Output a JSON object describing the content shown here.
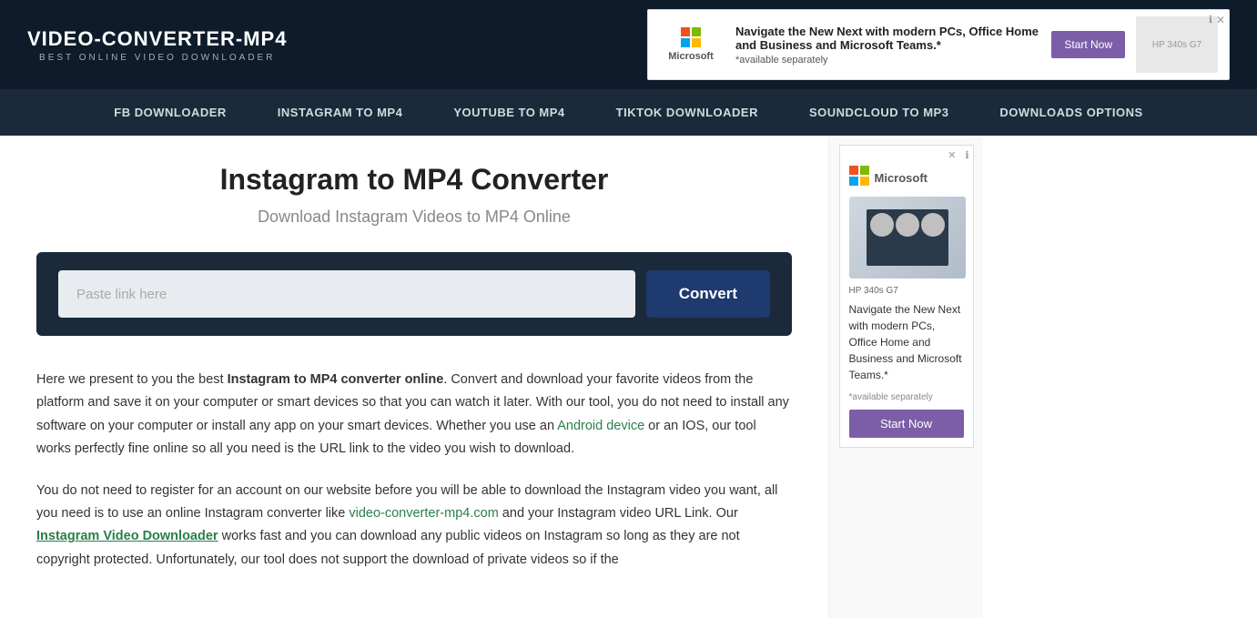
{
  "header": {
    "logo": {
      "title": "VIDEO-CONVERTER-MP4",
      "subtitle": "BEST ONLINE VIDEO DOWNLOADER"
    },
    "ad": {
      "brand": "Microsoft",
      "headline": "Navigate the New Next with modern PCs, Office Home and Business and Microsoft Teams.*",
      "footnote": "*available separately",
      "laptop_label": "HP 340s G7",
      "cta": "Start Now",
      "close": "✕",
      "info": "ℹ"
    }
  },
  "nav": {
    "items": [
      "FB DOWNLOADER",
      "INSTAGRAM TO MP4",
      "YOUTUBE TO MP4",
      "TIKTOK DOWNLOADER",
      "SOUNDCLOUD TO MP3",
      "DOWNLOADS OPTIONS"
    ]
  },
  "main": {
    "title": "Instagram to MP4 Converter",
    "subtitle": "Download Instagram Videos to MP4 Online",
    "input_placeholder": "Paste link here",
    "convert_button": "Convert",
    "body_paragraphs": [
      {
        "id": "p1",
        "parts": [
          {
            "type": "text",
            "content": "Here we present to you the best "
          },
          {
            "type": "bold",
            "content": "Instagram to MP4 converter online"
          },
          {
            "type": "text",
            "content": ". Convert and download your favorite videos from the platform and save it on your computer or smart devices so that you can watch it later. With our tool, you do not need to install any software on your computer or install any app on your smart devices. Whether you use an "
          },
          {
            "type": "link",
            "content": "Android device",
            "href": "#"
          },
          {
            "type": "text",
            "content": " or an IOS, our tool works perfectly fine online so all you need is the URL link to the video you wish to download."
          }
        ]
      },
      {
        "id": "p2",
        "parts": [
          {
            "type": "text",
            "content": "You do not need to register for an account on our website before you will be able to download the Instagram video you want, all you need is to use an online Instagram converter like "
          },
          {
            "type": "link",
            "content": "video-converter-mp4.com",
            "href": "#"
          },
          {
            "type": "text",
            "content": " and your Instagram video URL Link. Our "
          },
          {
            "type": "bold-link",
            "content": "Instagram Video Downloader",
            "href": "#"
          },
          {
            "type": "text",
            "content": " works fast and you can download any public videos on Instagram so long as they are not copyright protected. Unfortunately, our tool does not support the download of private videos so if the"
          }
        ]
      }
    ]
  },
  "sidebar_ad": {
    "brand": "Microsoft",
    "laptop_label": "HP 340s G7",
    "headline": "Navigate the New Next with modern PCs, Office Home and Business and Microsoft Teams.*",
    "footnote": "*available separately",
    "cta": "Start Now",
    "close": "✕",
    "info": "ℹ"
  }
}
